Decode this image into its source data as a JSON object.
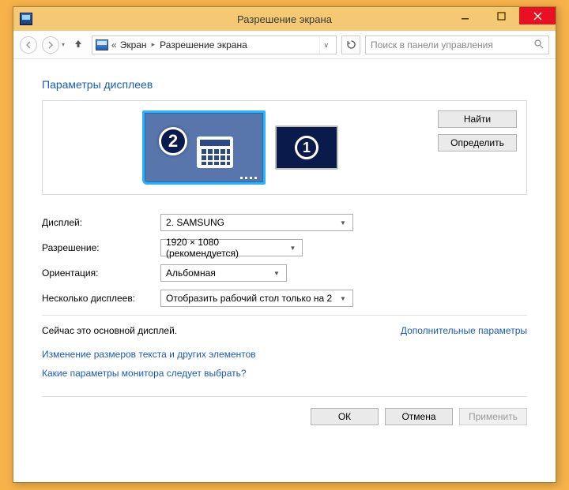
{
  "titlebar": {
    "title": "Разрешение экрана"
  },
  "nav": {
    "breadcrumb_prefix": "«",
    "seg1": "Экран",
    "seg2": "Разрешение экрана",
    "search_placeholder": "Поиск в панели управления"
  },
  "page": {
    "heading": "Параметры дисплеев",
    "btn_find": "Найти",
    "btn_detect": "Определить",
    "monitor2_num": "2",
    "monitor1_num": "1",
    "labels": {
      "display": "Дисплей:",
      "resolution": "Разрешение:",
      "orientation": "Ориентация:",
      "multiple": "Несколько дисплеев:"
    },
    "values": {
      "display": "2. SAMSUNG",
      "resolution": "1920 × 1080 (рекомендуется)",
      "orientation": "Альбомная",
      "multiple": "Отобразить рабочий стол только на 2"
    },
    "status_text": "Сейчас это основной дисплей.",
    "link_advanced": "Дополнительные параметры",
    "link_textsize": "Изменение размеров текста и других элементов",
    "link_which": "Какие параметры монитора следует выбрать?",
    "footer": {
      "ok": "ОК",
      "cancel": "Отмена",
      "apply": "Применить"
    }
  }
}
